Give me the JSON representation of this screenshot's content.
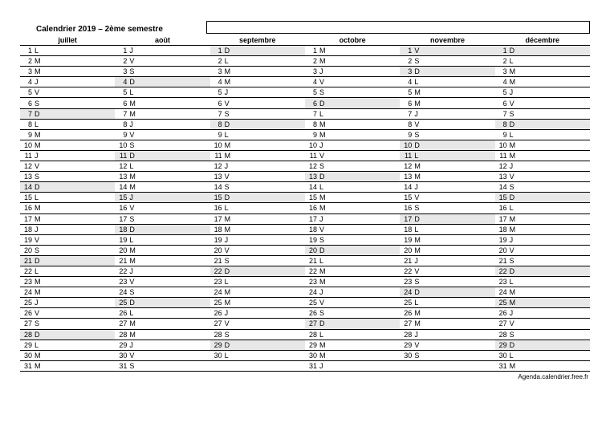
{
  "title": "Calendrier 2019 – 2ème semestre",
  "footer": "Agenda.calendrier.free.fr",
  "months": [
    {
      "name": "juillet",
      "days": [
        "L",
        "M",
        "M",
        "J",
        "V",
        "S",
        "D",
        "L",
        "M",
        "M",
        "J",
        "V",
        "S",
        "D",
        "L",
        "M",
        "M",
        "J",
        "V",
        "S",
        "D",
        "L",
        "M",
        "M",
        "J",
        "V",
        "S",
        "D",
        "L",
        "M",
        "M"
      ],
      "holidays": []
    },
    {
      "name": "août",
      "days": [
        "J",
        "V",
        "S",
        "D",
        "L",
        "M",
        "M",
        "J",
        "V",
        "S",
        "D",
        "L",
        "M",
        "M",
        "J",
        "V",
        "S",
        "D",
        "L",
        "M",
        "M",
        "J",
        "V",
        "S",
        "D",
        "L",
        "M",
        "M",
        "J",
        "V",
        "S"
      ],
      "holidays": [
        15
      ]
    },
    {
      "name": "septembre",
      "days": [
        "D",
        "L",
        "M",
        "M",
        "J",
        "V",
        "S",
        "D",
        "L",
        "M",
        "M",
        "J",
        "V",
        "S",
        "D",
        "L",
        "M",
        "M",
        "J",
        "V",
        "S",
        "D",
        "L",
        "M",
        "M",
        "J",
        "V",
        "S",
        "D",
        "L"
      ],
      "holidays": []
    },
    {
      "name": "octobre",
      "days": [
        "M",
        "M",
        "J",
        "V",
        "S",
        "D",
        "L",
        "M",
        "M",
        "J",
        "V",
        "S",
        "D",
        "L",
        "M",
        "M",
        "J",
        "V",
        "S",
        "D",
        "L",
        "M",
        "M",
        "J",
        "V",
        "S",
        "D",
        "L",
        "M",
        "M",
        "J"
      ],
      "holidays": []
    },
    {
      "name": "novembre",
      "days": [
        "V",
        "S",
        "D",
        "L",
        "M",
        "M",
        "J",
        "V",
        "S",
        "D",
        "L",
        "M",
        "M",
        "J",
        "V",
        "S",
        "D",
        "L",
        "M",
        "M",
        "J",
        "V",
        "S",
        "D",
        "L",
        "M",
        "M",
        "J",
        "V",
        "S"
      ],
      "holidays": [
        1,
        11
      ]
    },
    {
      "name": "décembre",
      "days": [
        "D",
        "L",
        "M",
        "M",
        "J",
        "V",
        "S",
        "D",
        "L",
        "M",
        "M",
        "J",
        "V",
        "S",
        "D",
        "L",
        "M",
        "M",
        "J",
        "V",
        "S",
        "D",
        "L",
        "M",
        "M",
        "J",
        "V",
        "S",
        "D",
        "L",
        "M"
      ],
      "holidays": [
        25
      ]
    }
  ]
}
